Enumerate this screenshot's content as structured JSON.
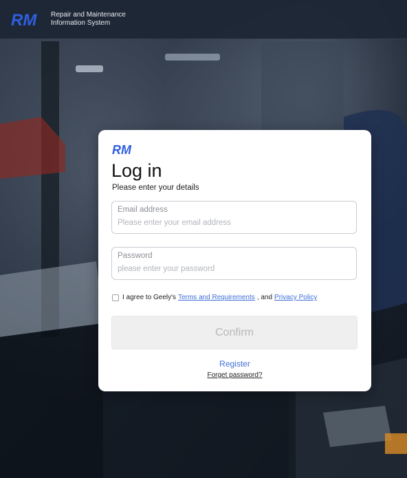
{
  "header": {
    "app_name_line1": "Repair and Maintenance",
    "app_name_line2": "Information System",
    "logo_text": "RM"
  },
  "login": {
    "logo_text": "RM",
    "title": "Log in",
    "subtitle": "Please enter your details",
    "email": {
      "label": "Email address",
      "placeholder": "Please enter your email address",
      "value": ""
    },
    "password": {
      "label": "Password",
      "placeholder": "please enter your password",
      "value": ""
    },
    "agreement": {
      "checked": false,
      "prefix": "I agree to Geely's",
      "terms_link": "Terms and Requirements",
      "separator": ", and",
      "privacy_link": "Privacy Policy"
    },
    "confirm_label": "Confirm",
    "register_label": "Register",
    "forget_label": "Forget password?"
  },
  "colors": {
    "brand_blue": "#2f5fe0",
    "link_blue": "#3e6fd8",
    "topbar_bg": "#1c2634",
    "button_disabled_bg": "#efefef"
  }
}
